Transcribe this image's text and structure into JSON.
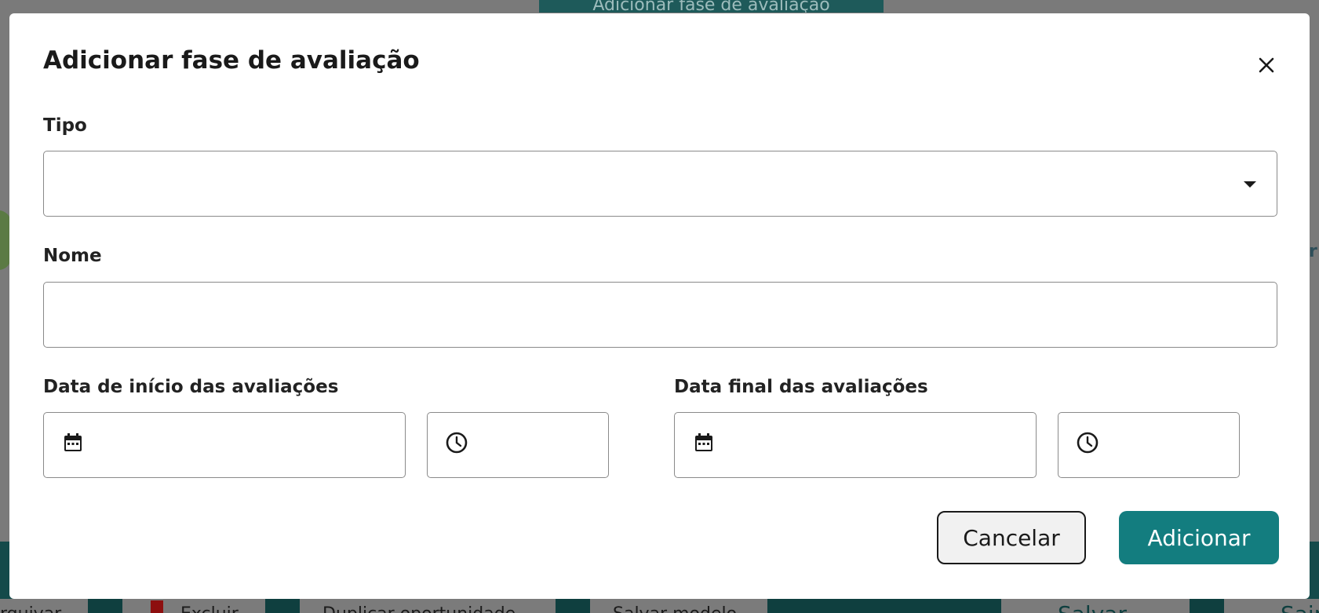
{
  "background": {
    "header_button": "Adicionar fase de avaliação",
    "right_text": "r",
    "toolbar": {
      "archive": "rquivar",
      "delete": "Excluir",
      "duplicate": "Duplicar oportunidade",
      "save_template": "Salvar modelo",
      "save": "Salvar",
      "exit": "Sair"
    }
  },
  "modal": {
    "title": "Adicionar fase de avaliação",
    "close_icon": "close-icon",
    "type": {
      "label": "Tipo",
      "value": ""
    },
    "name": {
      "label": "Nome",
      "value": ""
    },
    "start": {
      "label": "Data de início das avaliações",
      "date": "",
      "time": ""
    },
    "end": {
      "label": "Data final das avaliações",
      "date": "",
      "time": ""
    },
    "buttons": {
      "cancel": "Cancelar",
      "add": "Adicionar"
    },
    "colors": {
      "primary": "#137d7f",
      "overlay": "#7a7a7a"
    }
  }
}
